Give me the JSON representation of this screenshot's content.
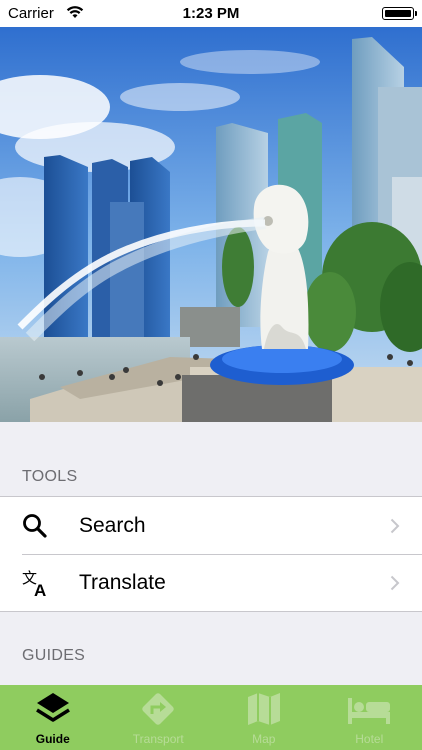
{
  "status_bar": {
    "carrier": "Carrier",
    "time": "1:23 PM",
    "battery_level": 0.95
  },
  "hero": {
    "icon": "merlion-photo"
  },
  "sections": {
    "tools": {
      "title": "TOOLS"
    },
    "guides": {
      "title": "GUIDES"
    }
  },
  "tools": [
    {
      "label": "Search",
      "icon": "search-icon"
    },
    {
      "label": "Translate",
      "icon": "translate-icon"
    }
  ],
  "tab_bar": {
    "tabs": [
      {
        "label": "Guide",
        "icon": "layers-icon",
        "active": true
      },
      {
        "label": "Transport",
        "icon": "directions-icon",
        "active": false
      },
      {
        "label": "Map",
        "icon": "map-icon",
        "active": false
      },
      {
        "label": "Hotel",
        "icon": "bed-icon",
        "active": false
      }
    ],
    "colors": {
      "background": "#8fcc5f",
      "active": "#000000",
      "inactive": "#b7dc97"
    }
  }
}
